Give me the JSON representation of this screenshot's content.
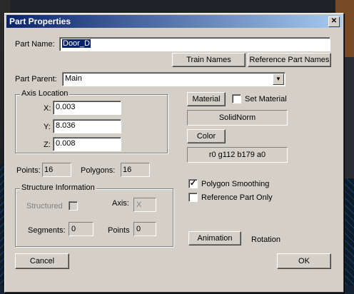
{
  "dialog": {
    "title": "Part Properties",
    "close_glyph": "✕"
  },
  "part_name": {
    "label": "Part Name:",
    "value": "Door_D"
  },
  "buttons": {
    "train_names": "Train Names",
    "reference_part_names": "Reference Part Names",
    "material": "Material",
    "color": "Color",
    "animation": "Animation",
    "cancel": "Cancel",
    "ok": "OK"
  },
  "part_parent": {
    "label": "Part Parent:",
    "value": "Main",
    "dropdown_icon": "chevron-down-icon"
  },
  "axis_location": {
    "title": "Axis Location",
    "x_label": "X:",
    "x_value": "0.003",
    "y_label": "Y:",
    "y_value": "8.036",
    "z_label": "Z:",
    "z_value": "0.008"
  },
  "material": {
    "set_material_label": "Set Material",
    "set_material_checked": false,
    "value": "SolidNorm"
  },
  "color": {
    "value": "r0 g112 b179 a0"
  },
  "stats": {
    "points_label": "Points:",
    "points_value": "16",
    "polygons_label": "Polygons:",
    "polygons_value": "16"
  },
  "options": {
    "polygon_smoothing_label": "Polygon Smoothing",
    "polygon_smoothing_checked": true,
    "reference_part_only_label": "Reference Part Only",
    "reference_part_only_checked": false
  },
  "structure": {
    "title": "Structure Information",
    "structured_label": "Structured",
    "axis_label": "Axis:",
    "axis_value": "X",
    "segments_label": "Segments:",
    "segments_value": "0",
    "points_label": "Points",
    "points_value": "0"
  },
  "rotation_label": "Rotation",
  "colors": {
    "titlebar_start": "#0a246a",
    "titlebar_end": "#a6caf0",
    "dialog_face": "#d4d0c8"
  }
}
